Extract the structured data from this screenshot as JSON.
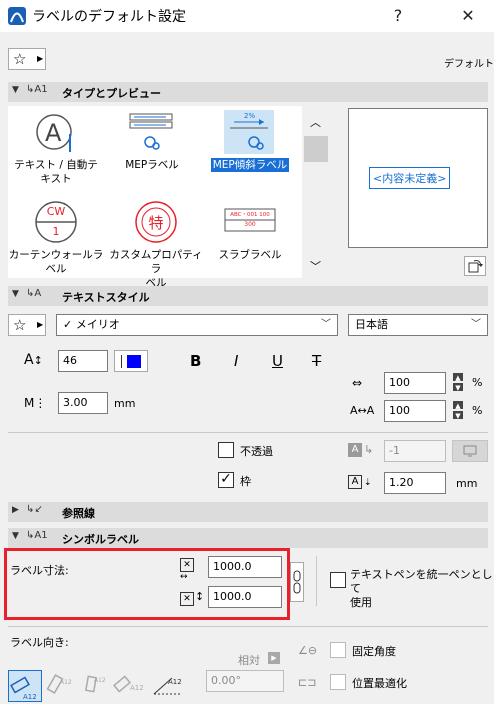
{
  "window": {
    "title": "ラベルのデフォルト設定",
    "help_label": "?",
    "close_label": "✕"
  },
  "header": {
    "default_label": "デフォルト"
  },
  "sections": {
    "type_preview": "タイプとプレビュー",
    "text_style": "テキストスタイル",
    "leader": "参照線",
    "symbol_label": "シンボルラベル"
  },
  "library": {
    "items": [
      {
        "label_line1": "テキスト / 自動テ",
        "label_line2": "キスト",
        "icon": "text-autotext-icon"
      },
      {
        "label_line1": "MEPラベル",
        "label_line2": "",
        "icon": "mep-label-icon"
      },
      {
        "label_line1": "MEP傾斜ラベル",
        "label_line2": "",
        "icon": "mep-slope-label-icon",
        "selected": true
      },
      {
        "label_line1": "カーテンウォールラ",
        "label_line2": "ベル",
        "icon": "curtain-wall-label-icon",
        "badge_top": "CW",
        "badge_bottom": "1"
      },
      {
        "label_line1": "カスタムプロパティラ",
        "label_line2": "ベル",
        "icon": "custom-property-label-icon",
        "badge": "特"
      },
      {
        "label_line1": "スラブラベル",
        "label_line2": "",
        "icon": "slab-label-icon",
        "tag_top": "ABC・001 100",
        "tag_bottom": "300"
      }
    ],
    "preview_text": "<内容未定義>"
  },
  "text_style": {
    "font": "メイリオ",
    "language": "日本語",
    "font_size": "46",
    "bold_label": "B",
    "italic_label": "I",
    "underline_label": "U",
    "strike_label": "T",
    "width_factor": "100",
    "spacing_factor": "100",
    "percent_unit": "%",
    "frame_offset": "3.00",
    "mm_unit": "mm",
    "opaque_label": "不透過",
    "frame_label": "枠",
    "pen_value": "-1",
    "frame_thickness": "1.20",
    "pen_color": "#0000ff"
  },
  "symbol_label": {
    "size_label": "ラベル寸法:",
    "width": "1000.0",
    "height": "1000.0",
    "unify_pen_label_line1": "テキストペンを統一ペンとして",
    "unify_pen_label_line2": "使用",
    "orientation_label": "ラベル向き:",
    "relative_label": "相対",
    "angle_value": "0.00°",
    "fixed_angle_label": "固定角度",
    "position_opt_label": "位置最適化",
    "highlight_color": "#e8202a"
  }
}
